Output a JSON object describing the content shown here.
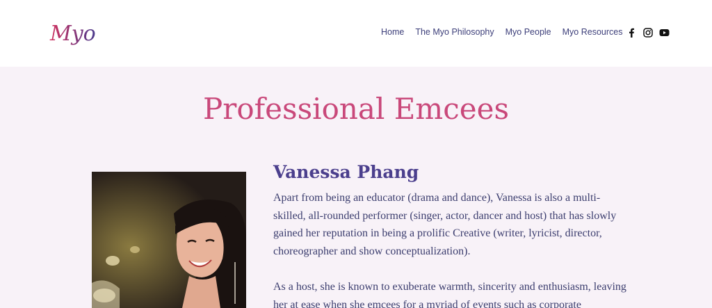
{
  "header": {
    "logo_text": "Myo",
    "nav": [
      "Home",
      "The Myo Philosophy",
      "Myo People",
      "Myo Resources"
    ],
    "social_icons": [
      "facebook-icon",
      "instagram-icon",
      "youtube-icon"
    ]
  },
  "main": {
    "title": "Professional Emcees",
    "profile": {
      "name": "Vanessa Phang",
      "paragraph1": "Apart from being an educator (drama and dance), Vanessa is also a multi-skilled, all-rounded performer (singer, actor, dancer and host) that has slowly gained her reputation in being a prolific Creative (writer, lyricist, director, choreographer and show conceptualization).",
      "paragraph2": "As a host, she is known to exuberate warmth, sincerity and enthusiasm, leaving her at ease when she emcees for a myriad of events such as corporate"
    }
  },
  "colors": {
    "header_bg": "#ffffff",
    "page_bg": "#f8f2f8",
    "title": "#c9487a",
    "name": "#4b3f8d",
    "body_text": "#3b3d6e",
    "nav_text": "#3d3f7a"
  }
}
